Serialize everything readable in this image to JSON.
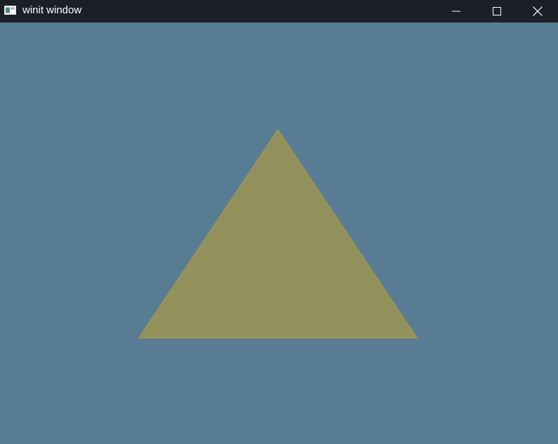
{
  "window": {
    "title": "winit window",
    "titlebar_color": "#1b1f27",
    "controls": [
      {
        "name": "minimize",
        "icon": "minimize-icon"
      },
      {
        "name": "maximize",
        "icon": "maximize-icon"
      },
      {
        "name": "close",
        "icon": "close-icon"
      }
    ]
  },
  "canvas": {
    "clear_color": "#587c94",
    "triangle_color": "#94925c"
  }
}
